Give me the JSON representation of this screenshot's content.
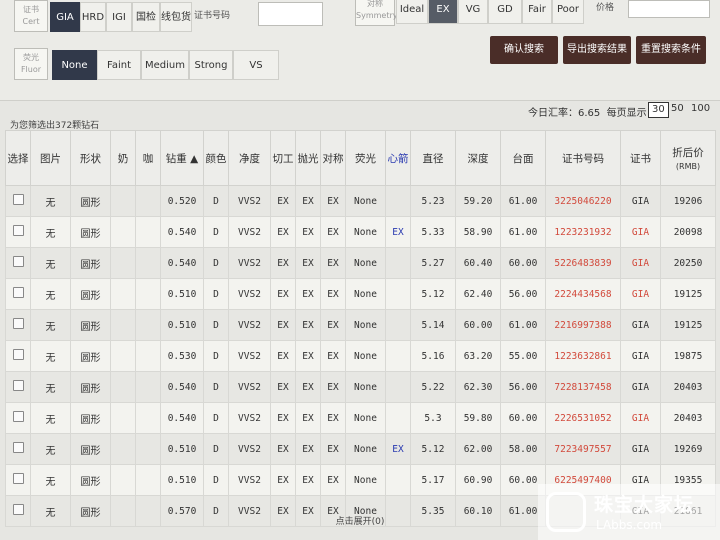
{
  "filters": {
    "cert_label": "证书",
    "cert_label_en": "Cert",
    "cert_options": [
      "GIA",
      "HRD",
      "IGI",
      "国检",
      "线包货"
    ],
    "cert_no_label": "证书号码",
    "sym_label": "对称",
    "sym_label_en": "Symmetry",
    "sym_options": [
      "Ideal",
      "EX",
      "VG",
      "GD",
      "Fair",
      "Poor"
    ],
    "price_label": "价格",
    "fluor_label": "荧光",
    "fluor_label_en": "Fluor",
    "fluor_options": [
      "None",
      "Faint",
      "Medium",
      "Strong",
      "VS"
    ],
    "btn_confirm": "确认搜索",
    "btn_export": "导出搜索结果",
    "btn_reset": "重置搜索条件"
  },
  "summary": {
    "count_text": "为您筛选出372颗钻石",
    "rate_text": "今日汇率：6.65",
    "page_size_label": "每页显示：",
    "page_sizes": [
      "30",
      "50",
      "100"
    ]
  },
  "table": {
    "headers": [
      "选择",
      "图片",
      "形状",
      "奶",
      "咖",
      "钻重 ▲",
      "颜色",
      "净度",
      "切工",
      "抛光",
      "对称",
      "荧光",
      "心箭",
      "直径",
      "深度",
      "台面",
      "证书号码",
      "证书",
      "折后价",
      "(RMB)"
    ],
    "rows": [
      [
        "无",
        "圆形",
        "0.520",
        "D",
        "VVS2",
        "EX",
        "EX",
        "EX",
        "None",
        "",
        "5.23",
        "59.20",
        "61.00",
        "3225046220",
        "GIA",
        "19206"
      ],
      [
        "无",
        "圆形",
        "0.540",
        "D",
        "VVS2",
        "EX",
        "EX",
        "EX",
        "None",
        "EX",
        "5.33",
        "58.90",
        "61.00",
        "1223231932",
        "GIA",
        "20098"
      ],
      [
        "无",
        "圆形",
        "0.540",
        "D",
        "VVS2",
        "EX",
        "EX",
        "EX",
        "None",
        "",
        "5.27",
        "60.40",
        "60.00",
        "5226483839",
        "GIA",
        "20250"
      ],
      [
        "无",
        "圆形",
        "0.510",
        "D",
        "VVS2",
        "EX",
        "EX",
        "EX",
        "None",
        "",
        "5.12",
        "62.40",
        "56.00",
        "2224434568",
        "GIA",
        "19125"
      ],
      [
        "无",
        "圆形",
        "0.510",
        "D",
        "VVS2",
        "EX",
        "EX",
        "EX",
        "None",
        "",
        "5.14",
        "60.00",
        "61.00",
        "2216997388",
        "GIA",
        "19125"
      ],
      [
        "无",
        "圆形",
        "0.530",
        "D",
        "VVS2",
        "EX",
        "EX",
        "EX",
        "None",
        "",
        "5.16",
        "63.20",
        "55.00",
        "1223632861",
        "GIA",
        "19875"
      ],
      [
        "无",
        "圆形",
        "0.540",
        "D",
        "VVS2",
        "EX",
        "EX",
        "EX",
        "None",
        "",
        "5.22",
        "62.30",
        "56.00",
        "7228137458",
        "GIA",
        "20403"
      ],
      [
        "无",
        "圆形",
        "0.540",
        "D",
        "VVS2",
        "EX",
        "EX",
        "EX",
        "None",
        "",
        "5.3",
        "59.80",
        "60.00",
        "2226531052",
        "GIA",
        "20403"
      ],
      [
        "无",
        "圆形",
        "0.510",
        "D",
        "VVS2",
        "EX",
        "EX",
        "EX",
        "None",
        "EX",
        "5.12",
        "62.00",
        "58.00",
        "7223497557",
        "GIA",
        "19269"
      ],
      [
        "无",
        "圆形",
        "0.510",
        "D",
        "VVS2",
        "EX",
        "EX",
        "EX",
        "None",
        "",
        "5.17",
        "60.90",
        "60.00",
        "6225497400",
        "GIA",
        "19355"
      ],
      [
        "无",
        "圆形",
        "0.570",
        "D",
        "VVS2",
        "EX",
        "EX",
        "EX",
        "None",
        "",
        "5.35",
        "60.10",
        "61.00",
        "",
        "GIA",
        "21861"
      ]
    ]
  },
  "footer": {
    "expand_text": "点击展开(0)"
  },
  "watermark": {
    "line1": "珠宝大家坛",
    "line2": "LAbbs.com"
  }
}
